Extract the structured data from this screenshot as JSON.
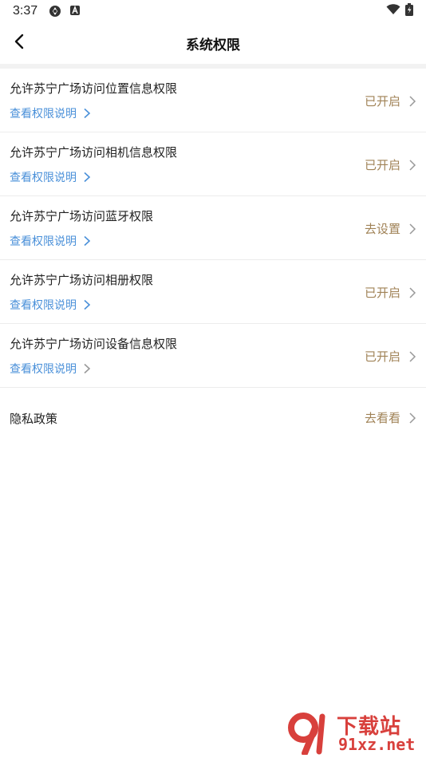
{
  "status_bar": {
    "time": "3:37"
  },
  "header": {
    "title": "系统权限"
  },
  "permissions": [
    {
      "title": "允许苏宁广场访问位置信息权限",
      "link": "查看权限说明",
      "status": "已开启"
    },
    {
      "title": "允许苏宁广场访问相机信息权限",
      "link": "查看权限说明",
      "status": "已开启"
    },
    {
      "title": "允许苏宁广场访问蓝牙权限",
      "link": "查看权限说明",
      "status": "去设置"
    },
    {
      "title": "允许苏宁广场访问相册权限",
      "link": "查看权限说明",
      "status": "已开启"
    },
    {
      "title": "允许苏宁广场访问设备信息权限",
      "link": "查看权限说明",
      "status": "已开启"
    }
  ],
  "privacy": {
    "title": "隐私政策",
    "action": "去看看"
  },
  "watermark": {
    "cn": "下载站",
    "en": "91xz.net"
  },
  "colors": {
    "link": "#4a90d9",
    "status": "#a08256",
    "watermark": "#d8403c"
  },
  "icons": {
    "back": "chevron-left-icon",
    "row_arrow": "chevron-right-icon"
  }
}
